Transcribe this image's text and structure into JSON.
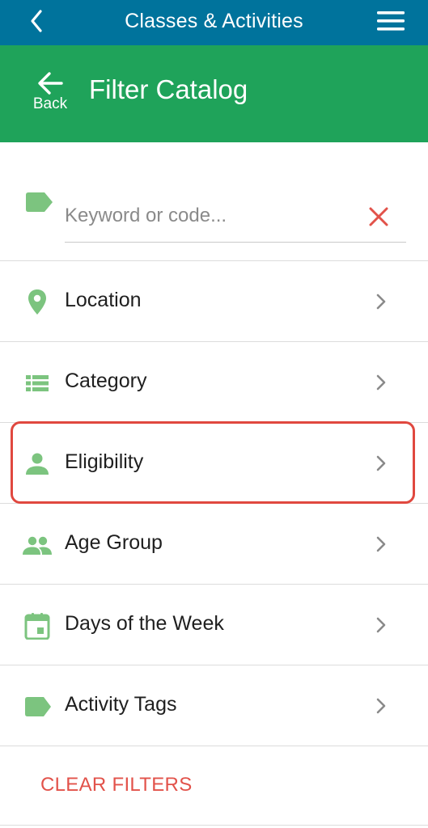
{
  "header": {
    "title": "Classes & Activities",
    "back_icon": "chevron-left-icon",
    "menu_icon": "hamburger-menu-icon"
  },
  "subheader": {
    "back_label": "Back",
    "page_title": "Filter Catalog"
  },
  "search": {
    "placeholder": "Keyword or code...",
    "value": "",
    "icon": "tag-icon",
    "clear_icon": "close-icon"
  },
  "filters": [
    {
      "label": "Location",
      "icon": "map-pin-icon"
    },
    {
      "label": "Category",
      "icon": "list-icon"
    },
    {
      "label": "Eligibility",
      "icon": "person-icon",
      "highlighted": true
    },
    {
      "label": "Age Group",
      "icon": "people-icon"
    },
    {
      "label": "Days of the Week",
      "icon": "calendar-icon"
    },
    {
      "label": "Activity Tags",
      "icon": "tag-icon"
    }
  ],
  "clear_filters_label": "CLEAR FILTERS",
  "colors": {
    "top_bar": "#00739c",
    "green_bar": "#1fa35a",
    "icon_green": "#7cc47f",
    "accent_red": "#e2524a",
    "highlight_border": "#e0483f"
  }
}
